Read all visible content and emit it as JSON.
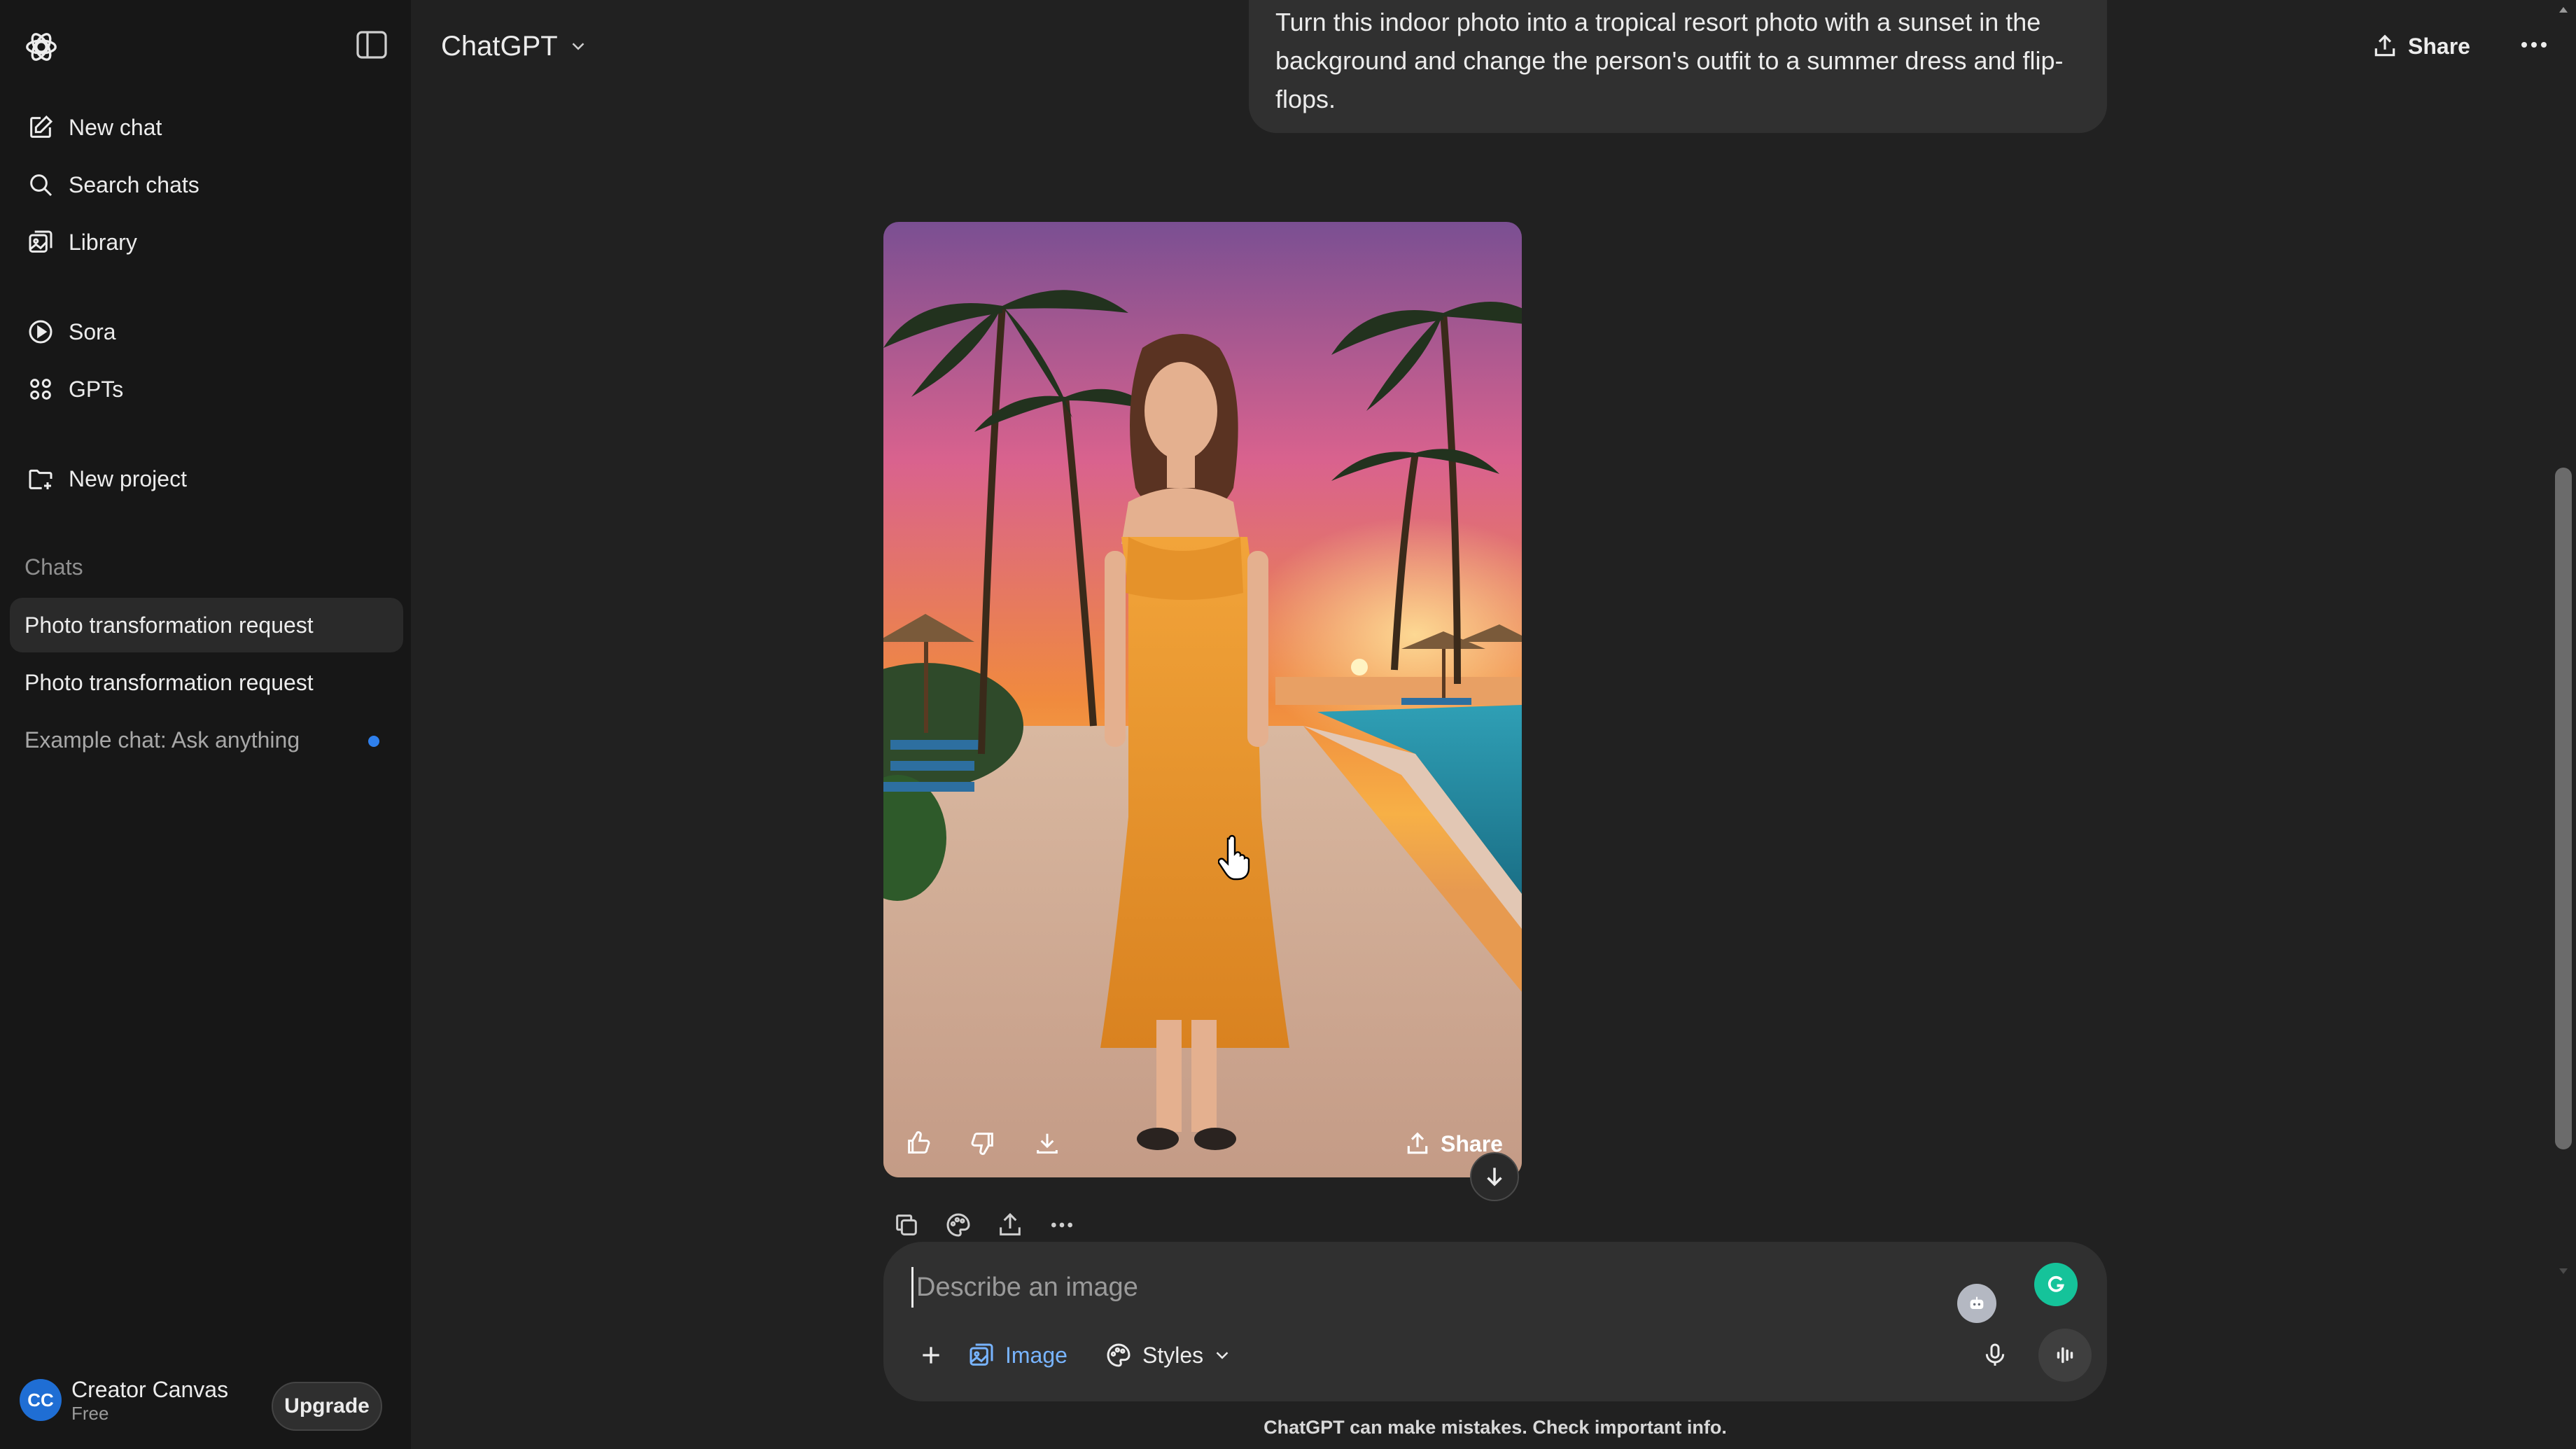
{
  "sidebar": {
    "nav": [
      {
        "label": "New chat",
        "icon": "edit-icon"
      },
      {
        "label": "Search chats",
        "icon": "search-icon"
      },
      {
        "label": "Library",
        "icon": "library-icon"
      },
      {
        "label": "Sora",
        "icon": "play-icon"
      },
      {
        "label": "GPTs",
        "icon": "grid-icon"
      },
      {
        "label": "New project",
        "icon": "folder-plus-icon"
      }
    ],
    "section_label": "Chats",
    "chats": [
      {
        "label": "Photo transformation request",
        "active": true
      },
      {
        "label": "Photo transformation request",
        "active": false
      },
      {
        "label": "Example chat: Ask anything",
        "active": false,
        "unread": true
      }
    ],
    "profile": {
      "initials": "CC",
      "name": "Creator Canvas",
      "plan": "Free"
    },
    "upgrade_label": "Upgrade"
  },
  "header": {
    "model": "ChatGPT",
    "share_label": "Share"
  },
  "conversation": {
    "user_message": "Turn this indoor photo into a tropical resort photo with a sunset in the background and change the person's outfit to a summer dress and flip-flops.",
    "image_share_label": "Share"
  },
  "composer": {
    "placeholder": "Describe an image",
    "image_label": "Image",
    "styles_label": "Styles"
  },
  "disclaimer": "ChatGPT can make mistakes. Check important info.",
  "colors": {
    "sidebar_bg": "#171717",
    "main_bg": "#212121",
    "bubble_bg": "#303030",
    "accent_blue": "#78b4ff",
    "grammarly_green": "#15c39a"
  }
}
